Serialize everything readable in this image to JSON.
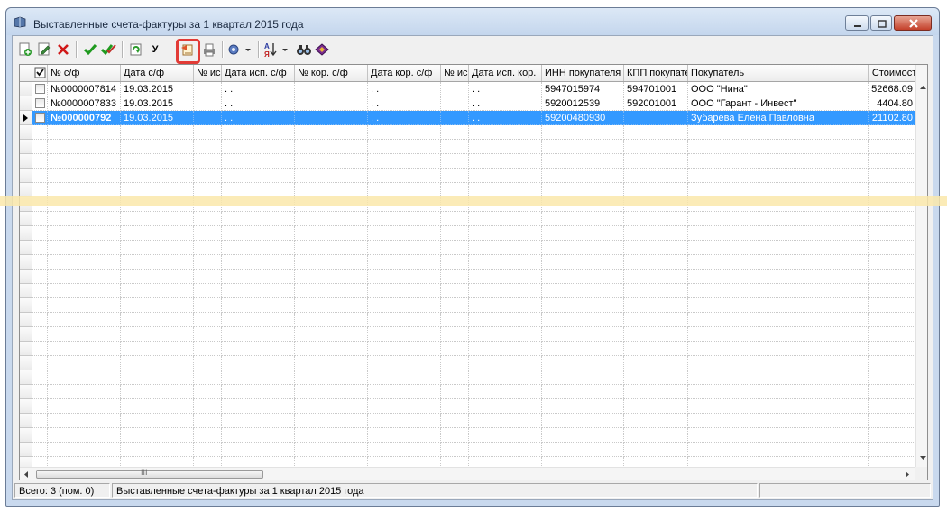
{
  "window": {
    "title": "Выставленные счета-фактуры за 1 квартал 2015 года"
  },
  "toolbar": {
    "buttons": [
      {
        "name": "add-icon",
        "label": ""
      },
      {
        "name": "edit-icon",
        "label": ""
      },
      {
        "name": "delete-icon",
        "label": ""
      },
      {
        "name": "check-icon",
        "label": ""
      },
      {
        "name": "check-all-icon",
        "label": ""
      },
      {
        "name": "refresh-icon",
        "label": ""
      },
      {
        "name": "letter-u",
        "label": "У"
      },
      {
        "name": "issue-document-icon",
        "label": ""
      },
      {
        "name": "print-icon",
        "label": ""
      },
      {
        "name": "settings-icon",
        "label": ""
      },
      {
        "name": "sort-icon",
        "label": ""
      },
      {
        "name": "find-icon",
        "label": ""
      },
      {
        "name": "book-icon",
        "label": ""
      }
    ]
  },
  "grid": {
    "columns": [
      "№ с/ф",
      "Дата с/ф",
      "№ исп",
      "Дата исп. с/ф",
      "№ кор. с/ф",
      "Дата кор. с/ф",
      "№ исп",
      "Дата исп. кор.",
      "ИНН покупателя",
      "КПП покупателя",
      "Покупатель",
      "Стоимость"
    ],
    "rows": [
      {
        "num": "№0000007814",
        "date": "19.03.2015",
        "fix_num": "",
        "fix_date": ". .",
        "cor_num": "",
        "cor_date": ". .",
        "cor_fix_num": "",
        "cor_fix_date": ". .",
        "inn": "5947015974",
        "kpp": "594701001",
        "buyer": "ООО \"Нина\"",
        "cost": "52668.09"
      },
      {
        "num": "№0000007833",
        "date": "19.03.2015",
        "fix_num": "",
        "fix_date": ". .",
        "cor_num": "",
        "cor_date": ". .",
        "cor_fix_num": "",
        "cor_fix_date": ". .",
        "inn": "5920012539",
        "kpp": "592001001",
        "buyer": "ООО \"Гарант - Инвест\"",
        "cost": "4404.80"
      },
      {
        "num": "№000000792",
        "date": "19.03.2015",
        "fix_num": "",
        "fix_date": ". .",
        "cor_num": "",
        "cor_date": ". .",
        "cor_fix_num": "",
        "cor_fix_date": ". .",
        "inn": "59200480930",
        "kpp": "",
        "buyer": "Зубарева Елена Павловна",
        "cost": "21102.80"
      }
    ],
    "selected_row": 2,
    "hscroll_thumb_label": "III"
  },
  "status": {
    "total": "Всего: 3 (пом. 0)",
    "description": "Выставленные счета-фактуры за 1 квартал 2015 года",
    "extra": ""
  }
}
